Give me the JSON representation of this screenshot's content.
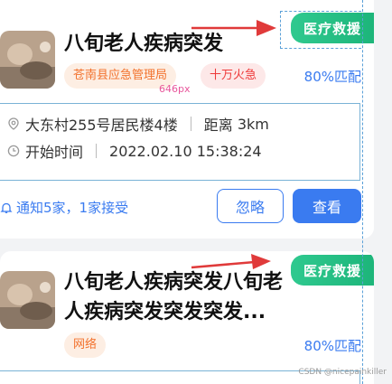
{
  "cards": [
    {
      "tag": "医疗救援",
      "title": "八旬老人疾病突发",
      "badges": [
        "苍南县应急管理局",
        "十万火急"
      ],
      "match": "80%匹配",
      "px_note": "646px",
      "address": "大东村255号居民楼4楼",
      "distance_label": "距离",
      "distance": "3km",
      "time_label": "开始时间",
      "time": "2022.02.10 15:38:24",
      "notice": "通知5家，1家接受",
      "ignore_label": "忽略",
      "view_label": "查看"
    },
    {
      "tag": "医疗救援",
      "title": "八旬老人疾病突发八旬老人疾病突发突发突发...",
      "badges": [
        "网络"
      ],
      "match": "80%匹配"
    }
  ],
  "watermark": "CSDN @nicepainkiller",
  "colors": {
    "tag_green": "#1db57a",
    "primary_blue": "#3a7bf0",
    "badge_orange": "#f2722d",
    "badge_red": "#ee3a3a",
    "arrow_red": "#e03a3a"
  }
}
